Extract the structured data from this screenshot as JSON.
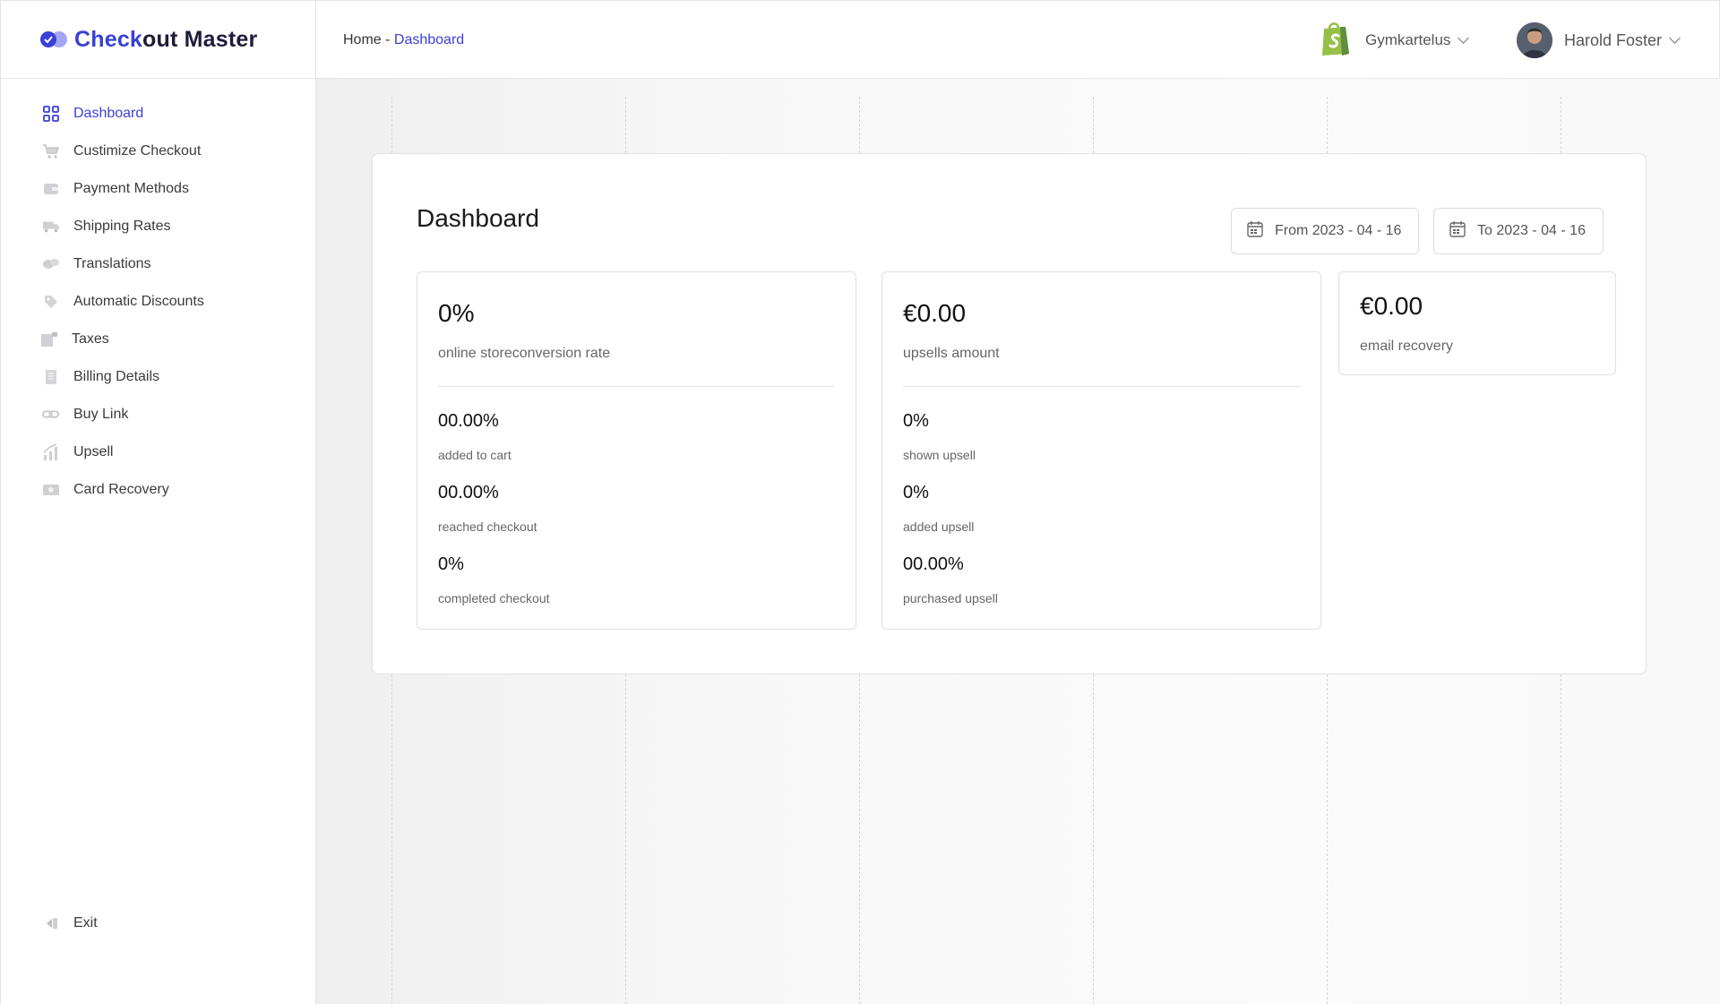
{
  "brand": {
    "name_part1": "Check",
    "name_part2": "out Master"
  },
  "sidebar": {
    "items": [
      {
        "label": "Dashboard",
        "icon": "grid-icon",
        "active": true
      },
      {
        "label": "Custimize Checkout",
        "icon": "cart-icon"
      },
      {
        "label": "Payment Methods",
        "icon": "wallet-icon"
      },
      {
        "label": "Shipping Rates",
        "icon": "truck-icon"
      },
      {
        "label": "Translations",
        "icon": "chat-icon"
      },
      {
        "label": "Automatic Discounts",
        "icon": "tag-icon"
      },
      {
        "label": "Taxes",
        "icon": "document-icon"
      },
      {
        "label": "Billing Details",
        "icon": "receipt-icon"
      },
      {
        "label": "Buy Link",
        "icon": "link-icon"
      },
      {
        "label": "Upsell",
        "icon": "chart-bar-icon"
      },
      {
        "label": "Card Recovery",
        "icon": "money-icon"
      }
    ],
    "exit_label": "Exit"
  },
  "header": {
    "breadcrumb_home": "Home - ",
    "breadcrumb_current": "Dashboard",
    "store_name": "Gymkartelus",
    "user_name": "Harold Foster"
  },
  "dashboard": {
    "title": "Dashboard",
    "date_from": "From 2023 - 04 - 16",
    "date_to": "To 2023 - 04 - 16",
    "conversion": {
      "value": "0%",
      "label": "online storeconversion rate",
      "stats": [
        {
          "value": "00.00%",
          "label": "added to cart"
        },
        {
          "value": "00.00%",
          "label": "reached checkout"
        },
        {
          "value": "0%",
          "label": "completed checkout"
        }
      ]
    },
    "upsells": {
      "value": "€0.00",
      "label": "upsells amount",
      "stats": [
        {
          "value": "0%",
          "label": "shown upsell"
        },
        {
          "value": "0%",
          "label": "added upsell"
        },
        {
          "value": "00.00%",
          "label": "purchased upsell"
        }
      ]
    },
    "email_recovery": {
      "value": "€0.00",
      "label": "email recovery"
    }
  },
  "colors": {
    "accent": "#3b3fd8",
    "shopify": "#95bf47"
  }
}
